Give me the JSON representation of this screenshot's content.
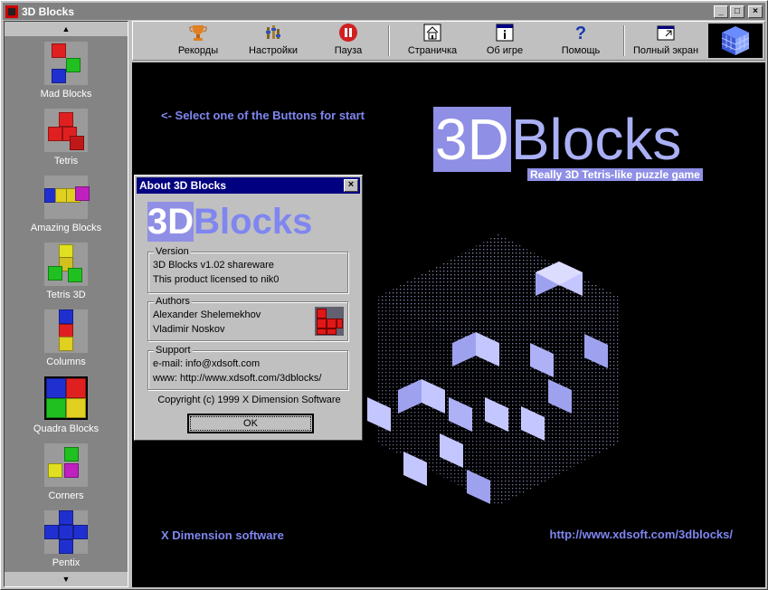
{
  "window": {
    "title": "3D Blocks",
    "minimize": "_",
    "maximize": "□",
    "close": "×"
  },
  "sidebar": {
    "scroll_up": "▲",
    "scroll_down": "▼",
    "items": [
      {
        "label": "Mad Blocks"
      },
      {
        "label": "Tetris"
      },
      {
        "label": "Amazing Blocks"
      },
      {
        "label": "Tetris 3D"
      },
      {
        "label": "Columns"
      },
      {
        "label": "Quadra Blocks"
      },
      {
        "label": "Corners"
      },
      {
        "label": "Pentix"
      }
    ]
  },
  "toolbar": {
    "records": "Рекорды",
    "settings": "Настройки",
    "pause": "Пауза",
    "homepage": "Страничка",
    "about": "Об игре",
    "help": "Помощь",
    "fullscreen": "Полный экран"
  },
  "main": {
    "hint": "<- Select one of the Buttons for start",
    "brand_3d": "3D",
    "brand_blocks": "Blocks",
    "brand_subtitle": "Really 3D Tetris-like puzzle game",
    "footer_left": "X Dimension software",
    "footer_right": "http://www.xdsoft.com/3dblocks/"
  },
  "dialog": {
    "title": "About 3D Blocks",
    "close": "×",
    "logo_3d": "3D",
    "logo_blocks": "Blocks",
    "version": {
      "legend": "Version",
      "line1": "3D Blocks v1.02 shareware",
      "line2": "This product licensed to nik0"
    },
    "authors": {
      "legend": "Authors",
      "line1": "Alexander Shelemekhov",
      "line2": "Vladimir Noskov"
    },
    "support": {
      "legend": "Support",
      "line1": "e-mail: info@xdsoft.com",
      "line2": "www:  http://www.xdsoft.com/3dblocks/"
    },
    "copyright": "Copyright (c) 1999 X Dimension Software",
    "ok": "OK"
  }
}
